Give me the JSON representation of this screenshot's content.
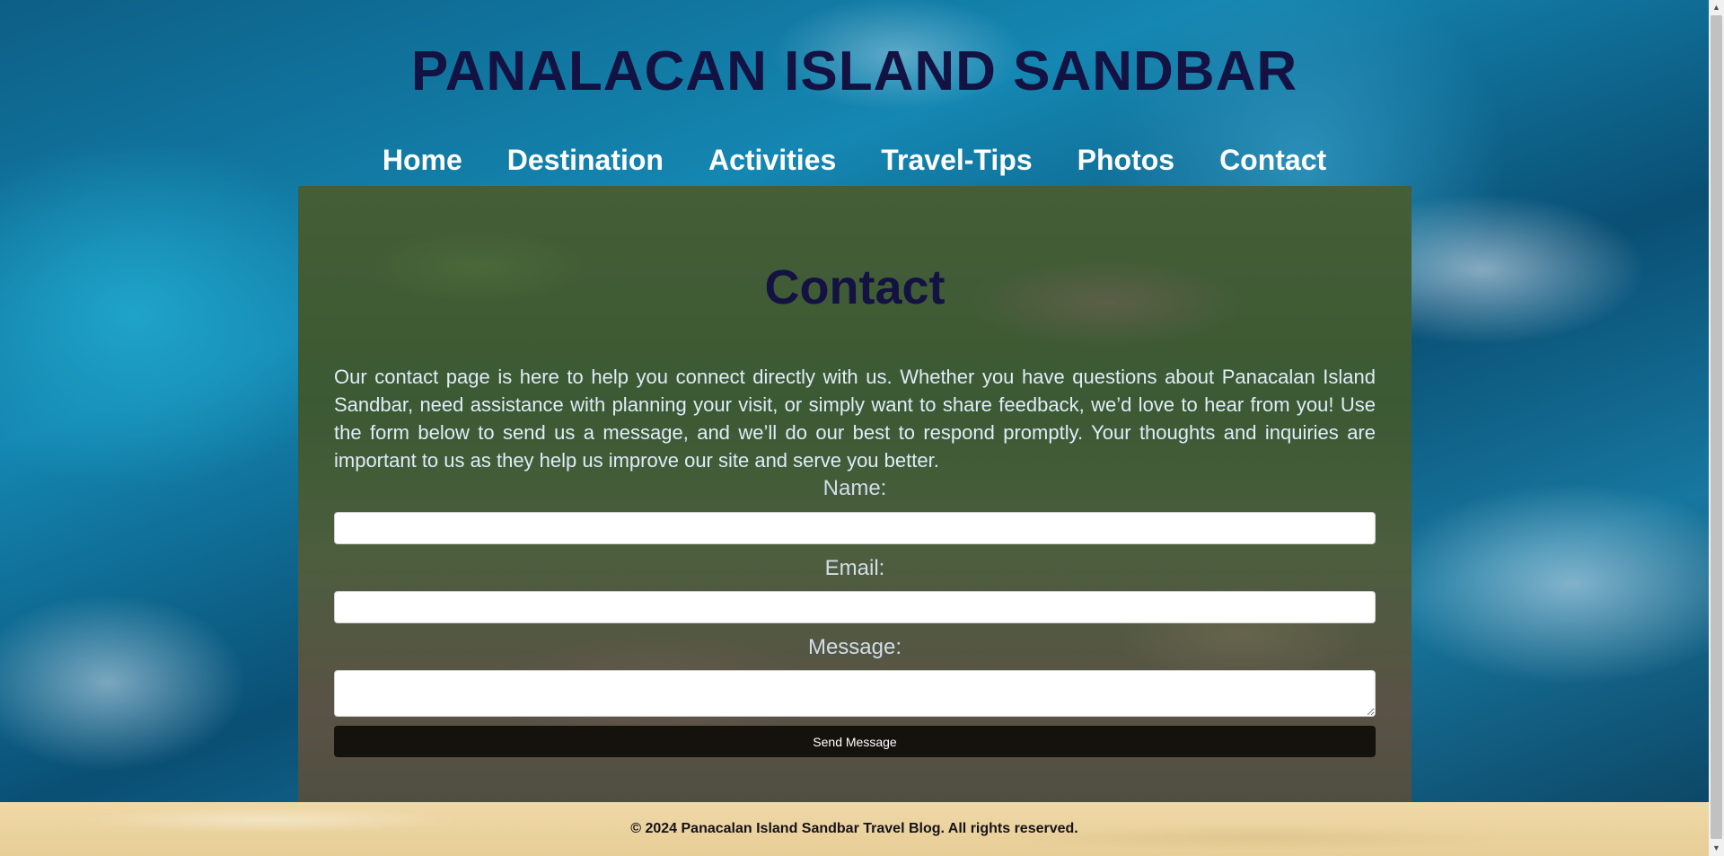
{
  "header": {
    "title": "PANALACAN ISLAND SANDBAR"
  },
  "nav": {
    "items": [
      "Home",
      "Destination",
      "Activities",
      "Travel-Tips",
      "Photos",
      "Contact"
    ]
  },
  "contact": {
    "title": "Contact",
    "intro": "Our contact page is here to help you connect directly with us. Whether you have questions about Panacalan Island Sandbar, need assistance with planning your visit, or simply want to share feedback, we’d love to hear from you! Use the form below to send us a message, and we’ll do our best to respond promptly. Your thoughts and inquiries are important to us as they help us improve our site and serve you better.",
    "form": {
      "name_label": "Name:",
      "name_value": "",
      "email_label": "Email:",
      "email_value": "",
      "message_label": "Message:",
      "message_value": "",
      "submit_label": "Send Message"
    }
  },
  "footer": {
    "text": "© 2024 Panacalan Island Sandbar Travel Blog. All rights reserved."
  },
  "colors": {
    "title": "#131242",
    "button": "#15120d",
    "footer_bg": "#efd9a8"
  },
  "icons": {
    "scroll_up": "scroll-up-arrow-icon",
    "scroll_down": "scroll-down-arrow-icon"
  }
}
